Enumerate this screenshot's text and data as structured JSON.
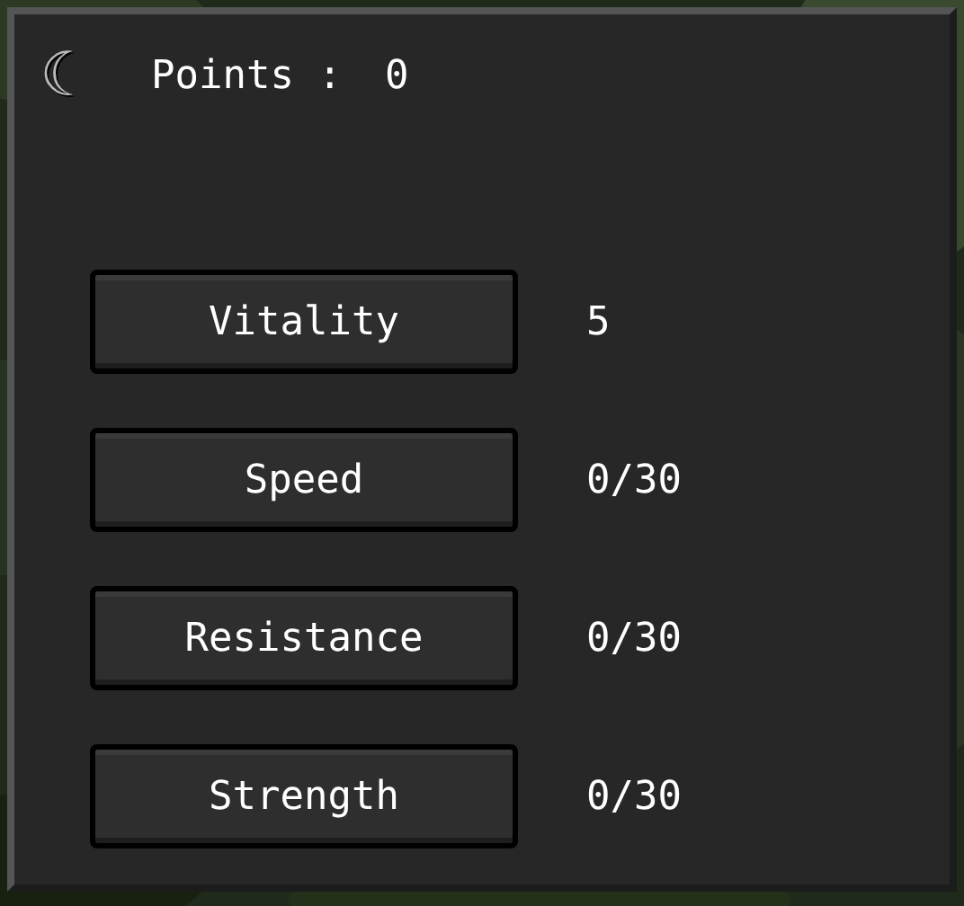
{
  "header": {
    "back_icon": "☾",
    "label": "Points :",
    "value": "0"
  },
  "attributes": [
    {
      "label": "Vitality",
      "value": "5"
    },
    {
      "label": "Speed",
      "value": "0/30"
    },
    {
      "label": "Resistance",
      "value": "0/30"
    },
    {
      "label": "Strength",
      "value": "0/30"
    }
  ]
}
